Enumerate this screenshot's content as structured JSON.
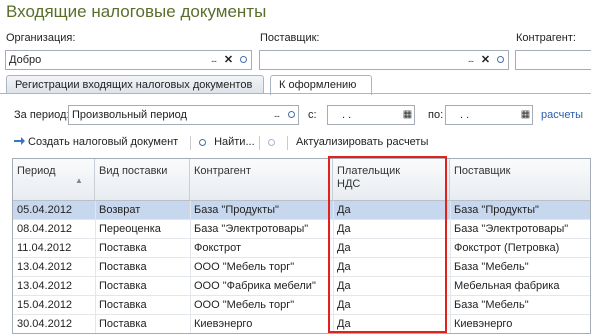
{
  "window": {
    "title": "Входящие налоговые документы"
  },
  "filters": {
    "organization": {
      "label": "Организация:",
      "value": "Добро"
    },
    "supplier": {
      "label": "Поставщик:",
      "value": ""
    },
    "counterparty": {
      "label": "Контрагент:",
      "value": ""
    }
  },
  "tabs": [
    {
      "label": "Регистрации входящих налоговых документов",
      "active": false
    },
    {
      "label": "К оформлению",
      "active": true
    }
  ],
  "period": {
    "label": "За период:",
    "value": "Произвольный период",
    "from_label": "с:",
    "from_value": ".  .",
    "to_label": "по:",
    "to_value": ".  .",
    "link": "расчеты"
  },
  "toolbar": {
    "create": "Создать налоговый документ",
    "find": "Найти...",
    "refresh": "Актуализировать расчеты"
  },
  "table": {
    "columns": [
      "Период",
      "Вид поставки",
      "Контрагент",
      "Плательщик НДС",
      "Поставщик"
    ],
    "column_lines": [
      [
        "Период"
      ],
      [
        "Вид поставки"
      ],
      [
        "Контрагент"
      ],
      [
        "Плательщик",
        "НДС"
      ],
      [
        "Поставщик"
      ]
    ],
    "rows": [
      [
        "05.04.2012",
        "Возврат",
        "База \"Продукты\"",
        "Да",
        "База \"Продукты\""
      ],
      [
        "08.04.2012",
        "Переоценка",
        "База \"Электротовары\"",
        "Да",
        "База \"Электротовары\""
      ],
      [
        "11.04.2012",
        "Поставка",
        "Фокстрот",
        "Да",
        "Фокстрот (Петровка)"
      ],
      [
        "13.04.2012",
        "Поставка",
        "ООО \"Мебель торг\"",
        "Да",
        "База \"Мебель\""
      ],
      [
        "13.04.2012",
        "Поставка",
        "ООО \"Фабрика мебели\"",
        "Да",
        "Мебельная фабрика"
      ],
      [
        "15.04.2012",
        "Поставка",
        "ООО \"Мебель торг\"",
        "Да",
        "База \"Мебель\""
      ],
      [
        "30.04.2012",
        "Поставка",
        "Киевэнерго",
        "Да",
        "Киевэнерго"
      ]
    ],
    "selected_row": 0
  },
  "colors": {
    "title": "#5a6e2c",
    "highlight": "#e2211c",
    "selection": "#c6d7ee",
    "link": "#2d5db0"
  }
}
